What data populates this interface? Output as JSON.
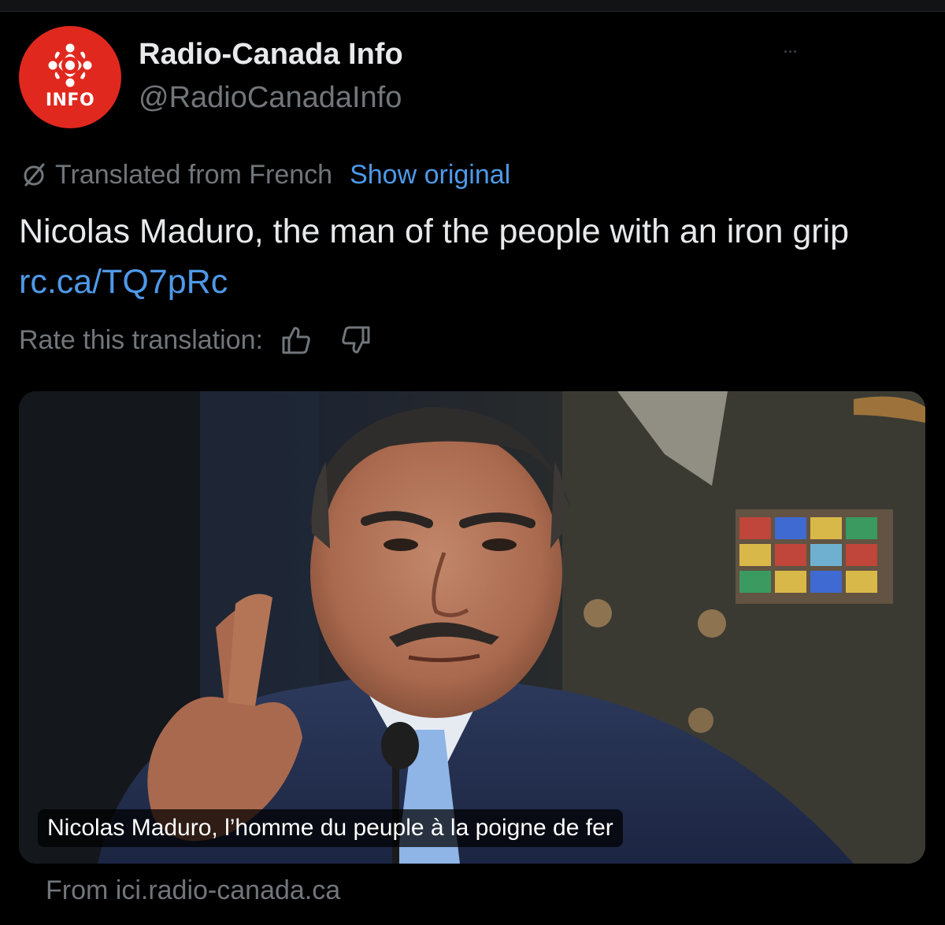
{
  "author": {
    "display_name": "Radio-Canada Info",
    "handle": "@RadioCanadaInfo",
    "avatar_label": "INFO",
    "avatar_color": "#e0281f"
  },
  "translation": {
    "notice": "Translated from French",
    "show_original_label": "Show original",
    "rate_label": "Rate this translation:"
  },
  "tweet": {
    "text": "Nicolas Maduro, the man of the people with an iron grip",
    "link": "rc.ca/TQ7pRc"
  },
  "card": {
    "caption": "Nicolas Maduro, l’homme du peuple à la poigne de fer",
    "source": "From ici.radio-canada.ca"
  },
  "icons": {
    "translated": "globe-slash-icon",
    "thumbs_up": "thumbs-up-icon",
    "thumbs_down": "thumbs-down-icon"
  },
  "colors": {
    "background": "#000000",
    "primary_text": "#e7e9ea",
    "secondary_text": "#71767b",
    "link": "#4e99e8"
  }
}
